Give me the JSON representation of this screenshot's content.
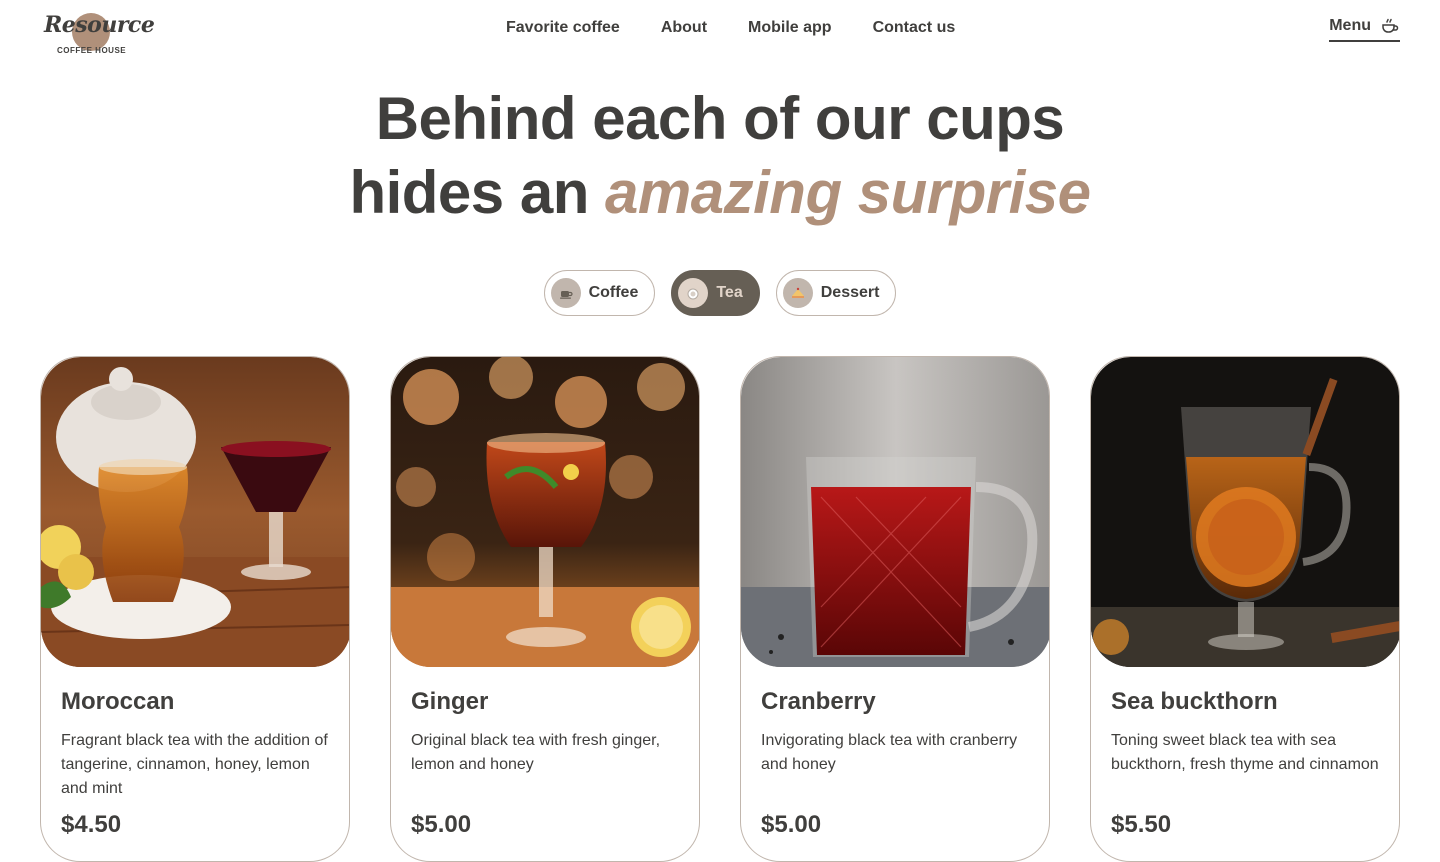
{
  "logo": {
    "script": "Resource",
    "sub": "COFFEE HOUSE"
  },
  "nav": [
    {
      "label": "Favorite coffee"
    },
    {
      "label": "About"
    },
    {
      "label": "Mobile app"
    },
    {
      "label": "Contact us"
    }
  ],
  "menu": {
    "label": "Menu",
    "icon": "coffee-cup-icon"
  },
  "hero": {
    "line1": "Behind each of our cups",
    "line2_plain": "hides an ",
    "line2_accent": "amazing surprise"
  },
  "tabs": [
    {
      "label": "Coffee",
      "icon": "coffee-icon",
      "active": false
    },
    {
      "label": "Tea",
      "icon": "tea-icon",
      "active": true
    },
    {
      "label": "Dessert",
      "icon": "dessert-icon",
      "active": false
    }
  ],
  "products": [
    {
      "name": "Moroccan",
      "description": "Fragrant black tea with the addition of tangerine, cinnamon, honey, lemon and mint",
      "price": "$4.50"
    },
    {
      "name": "Ginger",
      "description": "Original black tea with fresh ginger, lemon and honey",
      "price": "$5.00"
    },
    {
      "name": "Cranberry",
      "description": "Invigorating black tea with cranberry and honey",
      "price": "$5.00"
    },
    {
      "name": "Sea buckthorn",
      "description": "Toning sweet black tea with sea buckthorn, fresh thyme and cinnamon",
      "price": "$5.50"
    }
  ],
  "colors": {
    "dark": "#403f3d",
    "accent": "#b0907a",
    "border": "#c1b6ad",
    "active_tab": "#665f55",
    "active_text": "#e1d4c9"
  }
}
